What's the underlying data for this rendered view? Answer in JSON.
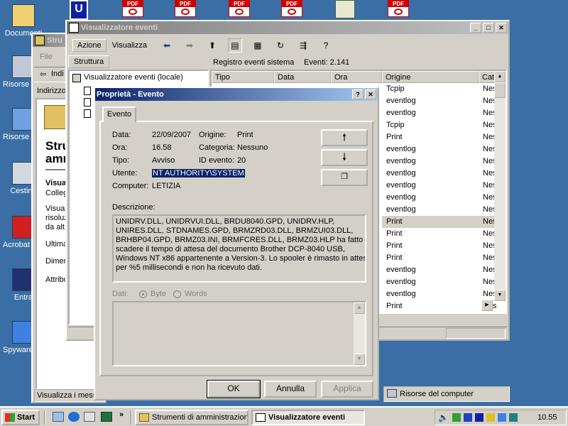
{
  "desktop": {
    "icons": [
      {
        "label": "Documenti",
        "color": "#f0d070"
      },
      {
        "label": "Risorse del computer",
        "color": "#c0c8d8"
      },
      {
        "label": "Risorse di rete",
        "color": "#70a0e0"
      },
      {
        "label": "Cestino",
        "color": "#d0d8e0"
      },
      {
        "label": "Acrobat Reader",
        "color": "#d02020"
      },
      {
        "label": "Entra",
        "color": "#203070"
      },
      {
        "label": "Spyware Terminator",
        "color": "#4080e0"
      }
    ],
    "pdf_label": "PDF"
  },
  "back_window": {
    "title": "Strumenti di amministrazione",
    "title_short": "Stru",
    "menu_file": "File",
    "back_label": "Indi",
    "address_label": "Indirizzo",
    "heading_1": "Stru",
    "heading_2": "amm",
    "visual_1": "Visua",
    "visual_2": "Colleg",
    "desc_1": "Visual",
    "desc_2": "risoluz",
    "desc_3": "da alt",
    "ultima": "Ultima",
    "dimen": "Dimen",
    "attrib": "Attribu",
    "status": "Visualizza i messa",
    "status_right": "Risorse del computer"
  },
  "event_viewer": {
    "title": "Visualizzatore eventi",
    "menu": {
      "azione": "Azione",
      "visualizza": "Visualizza"
    },
    "tree_tab": "Struttura",
    "tree_root": "Visualizzatore eventi (locale)",
    "list_title": "Registro eventi sistema",
    "events_count": "Eventi: 2.141",
    "columns": {
      "tipo": "Tipo",
      "data": "Data",
      "ora": "Ora",
      "origine": "Origine",
      "cat": "Cat"
    },
    "rows": [
      {
        "origine": "Tcpip",
        "cat": "Nes"
      },
      {
        "origine": "eventlog",
        "cat": "Nes"
      },
      {
        "origine": "eventlog",
        "cat": "Nes"
      },
      {
        "origine": "Tcpip",
        "cat": "Nes"
      },
      {
        "origine": "Print",
        "cat": "Nes"
      },
      {
        "origine": "eventlog",
        "cat": "Nes"
      },
      {
        "origine": "eventlog",
        "cat": "Nes"
      },
      {
        "origine": "eventlog",
        "cat": "Nes"
      },
      {
        "origine": "eventlog",
        "cat": "Nes"
      },
      {
        "origine": "eventlog",
        "cat": "Nes"
      },
      {
        "origine": "eventlog",
        "cat": "Nes"
      },
      {
        "origine": "Print",
        "cat": "Nes"
      },
      {
        "origine": "Print",
        "cat": "Nes"
      },
      {
        "origine": "Print",
        "cat": "Nes"
      },
      {
        "origine": "Print",
        "cat": "Nes"
      },
      {
        "origine": "eventlog",
        "cat": "Nes"
      },
      {
        "origine": "eventlog",
        "cat": "Nes"
      },
      {
        "origine": "eventlog",
        "cat": "Nes"
      },
      {
        "origine": "Print",
        "cat": "Nes"
      }
    ],
    "selected_row": 11
  },
  "dialog": {
    "title": "Proprietà - Evento",
    "help_btn": "?",
    "close_btn": "✕",
    "tab": "Evento",
    "labels": {
      "data": "Data:",
      "ora": "Ora:",
      "tipo": "Tipo:",
      "utente": "Utente:",
      "computer": "Computer:",
      "origine": "Origine:",
      "categoria": "Categoria:",
      "id_evento": "ID evento:",
      "descrizione": "Descrizione:",
      "dati": "Dati:",
      "byte": "Byte",
      "words": "Words"
    },
    "values": {
      "data": "22/09/2007",
      "ora": "16.58",
      "tipo": "Avviso",
      "utente": "NT AUTHORITY\\SYSTEM",
      "computer": "LETIZIA",
      "origine": "Print",
      "categoria": "Nessuno",
      "id_evento": "20"
    },
    "description_lines": [
      "UNIDRV.DLL, UNIDRVUI.DLL, BRDU8040.GPD, UNIDRV.HLP,",
      "UNIRES.DLL, STDNAMES.GPD, BRMZRD03.DLL, BRMZUI03.DLL,",
      "BRHBP04.GPD, BRMZ03.INI, BRMFCRES.DLL, BRMZ03.HLP ha fatto",
      "scadere il tempo di attesa del documento Brother DCP-8040 USB,",
      "Windows NT x86 appartenente a Version-3. Lo spooler è rimasto in attesa",
      "per %5 millisecondi e non ha ricevuto dati."
    ],
    "buttons": {
      "ok": "OK",
      "annulla": "Annulla",
      "applica": "Applica"
    }
  },
  "taskbar": {
    "start": "Start",
    "task_1": "Strumenti di amministrazione",
    "task_2": "Visualizzatore eventi",
    "clock": "10.55",
    "quicklaunch_more": "»"
  }
}
